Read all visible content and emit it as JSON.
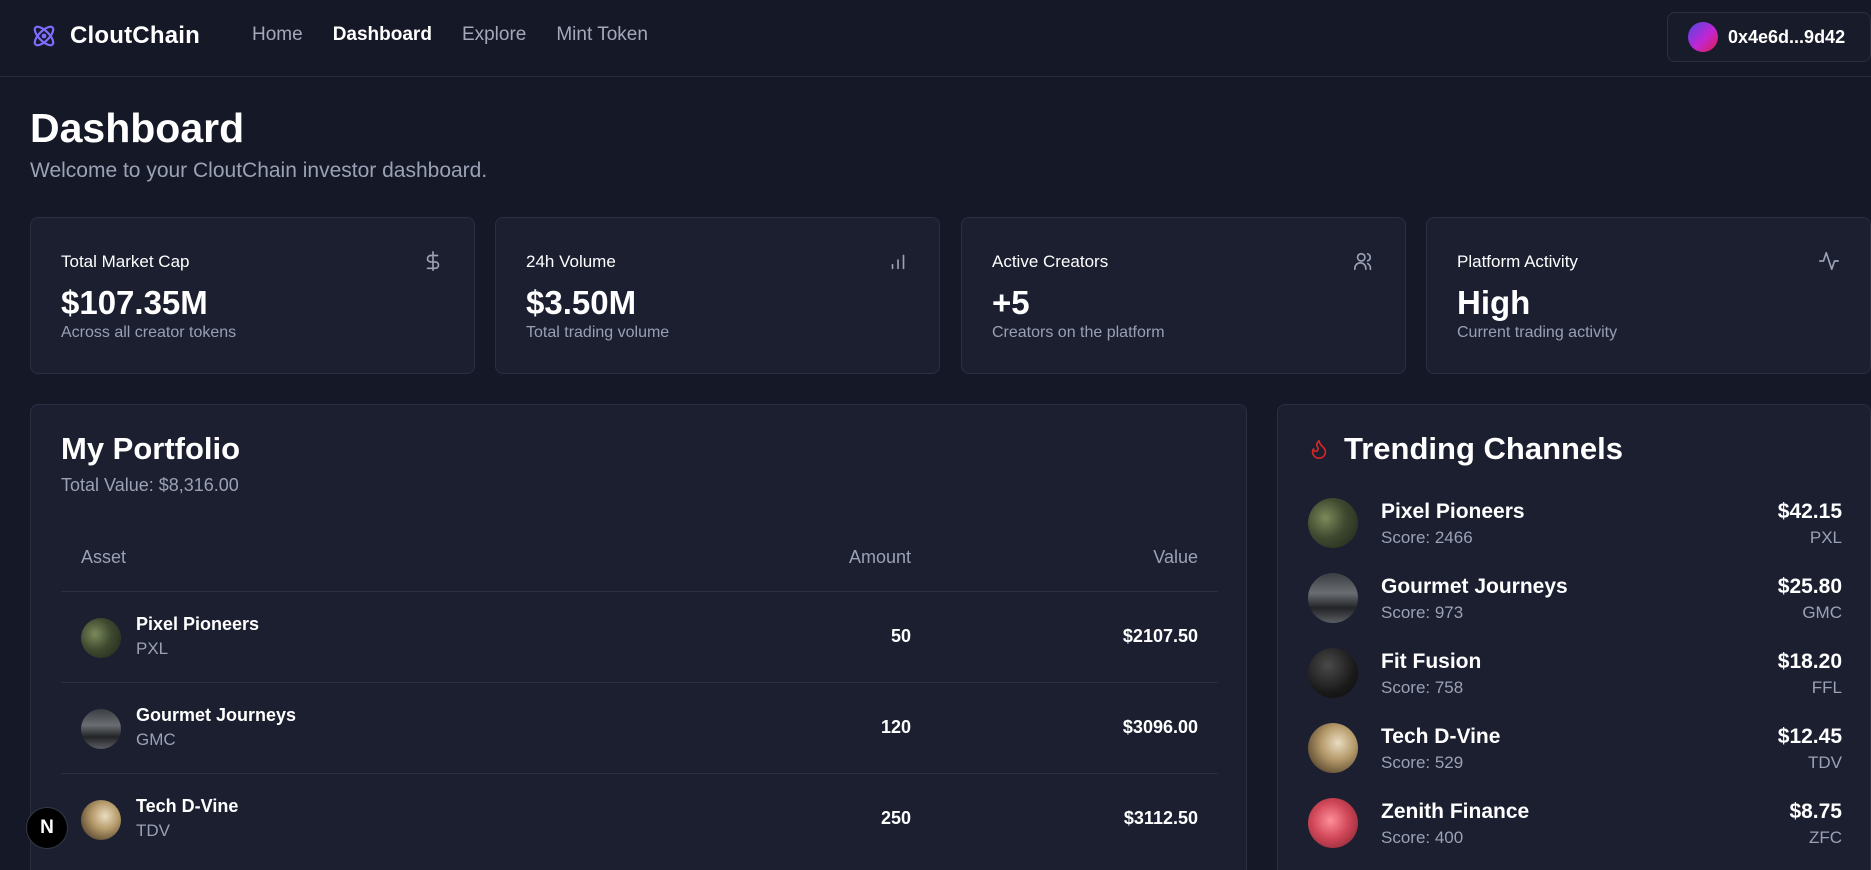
{
  "brand": {
    "name": "CloutChain",
    "logo_icon": "atom-icon",
    "accent": "#6d5dfc"
  },
  "nav": {
    "items": [
      {
        "label": "Home",
        "active": false
      },
      {
        "label": "Dashboard",
        "active": true
      },
      {
        "label": "Explore",
        "active": false
      },
      {
        "label": "Mint Token",
        "active": false
      }
    ]
  },
  "wallet": {
    "address": "0x4e6d...9d42",
    "avatar_icon": "gradient-avatar"
  },
  "page": {
    "title": "Dashboard",
    "subtitle": "Welcome to your CloutChain investor dashboard."
  },
  "stats": [
    {
      "title": "Total Market Cap",
      "value": "$107.35M",
      "desc": "Across all creator tokens",
      "icon": "dollar-icon"
    },
    {
      "title": "24h Volume",
      "value": "$3.50M",
      "desc": "Total trading volume",
      "icon": "bar-chart-icon"
    },
    {
      "title": "Active Creators",
      "value": "+5",
      "desc": "Creators on the platform",
      "icon": "users-icon"
    },
    {
      "title": "Platform Activity",
      "value": "High",
      "desc": "Current trading activity",
      "icon": "activity-icon"
    }
  ],
  "portfolio": {
    "title": "My Portfolio",
    "total": "Total Value: $8,316.00",
    "columns": {
      "asset": "Asset",
      "amount": "Amount",
      "value": "Value"
    },
    "rows": [
      {
        "name": "Pixel Pioneers",
        "symbol": "PXL",
        "amount": "50",
        "value": "$2107.50"
      },
      {
        "name": "Gourmet Journeys",
        "symbol": "GMC",
        "amount": "120",
        "value": "$3096.00"
      },
      {
        "name": "Tech D-Vine",
        "symbol": "TDV",
        "amount": "250",
        "value": "$3112.50"
      }
    ]
  },
  "trending": {
    "title": "Trending Channels",
    "icon": "flame-icon",
    "icon_color": "#dc2626",
    "rows": [
      {
        "name": "Pixel Pioneers",
        "score": "Score: 2466",
        "price": "$42.15",
        "symbol": "PXL"
      },
      {
        "name": "Gourmet Journeys",
        "score": "Score: 973",
        "price": "$25.80",
        "symbol": "GMC"
      },
      {
        "name": "Fit Fusion",
        "score": "Score: 758",
        "price": "$18.20",
        "symbol": "FFL"
      },
      {
        "name": "Tech D-Vine",
        "score": "Score: 529",
        "price": "$12.45",
        "symbol": "TDV"
      },
      {
        "name": "Zenith Finance",
        "score": "Score: 400",
        "price": "$8.75",
        "symbol": "ZFC"
      }
    ]
  },
  "next_badge": {
    "label": "N"
  }
}
